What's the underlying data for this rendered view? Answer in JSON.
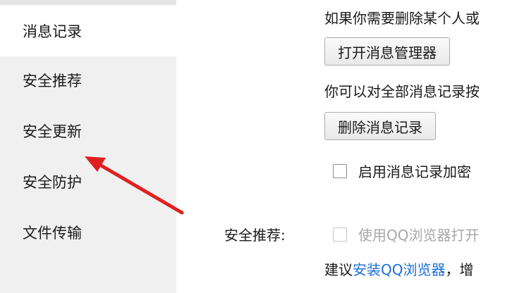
{
  "sidebar": {
    "items": [
      {
        "label": "消息记录",
        "active": true
      },
      {
        "label": "安全推荐",
        "active": false
      },
      {
        "label": "安全更新",
        "active": false
      },
      {
        "label": "安全防护",
        "active": false
      },
      {
        "label": "文件传输",
        "active": false
      }
    ]
  },
  "main": {
    "delete_hint": "如果你需要删除某个人或",
    "open_manager_button": "打开消息管理器",
    "all_records_hint": "你可以对全部消息记录按",
    "delete_records_button": "删除消息记录",
    "enable_encryption_label": "启用消息记录加密",
    "security_recommend_label": "安全推荐:",
    "use_qq_browser_label": "使用QQ浏览器打开",
    "suggest_prefix": "建议",
    "install_link": "安装QQ浏览器",
    "suggest_suffix": "，增"
  },
  "colors": {
    "sidebar_bg": "#f0f0f0",
    "link": "#1a6fd8",
    "annotation_arrow": "#e02020"
  }
}
